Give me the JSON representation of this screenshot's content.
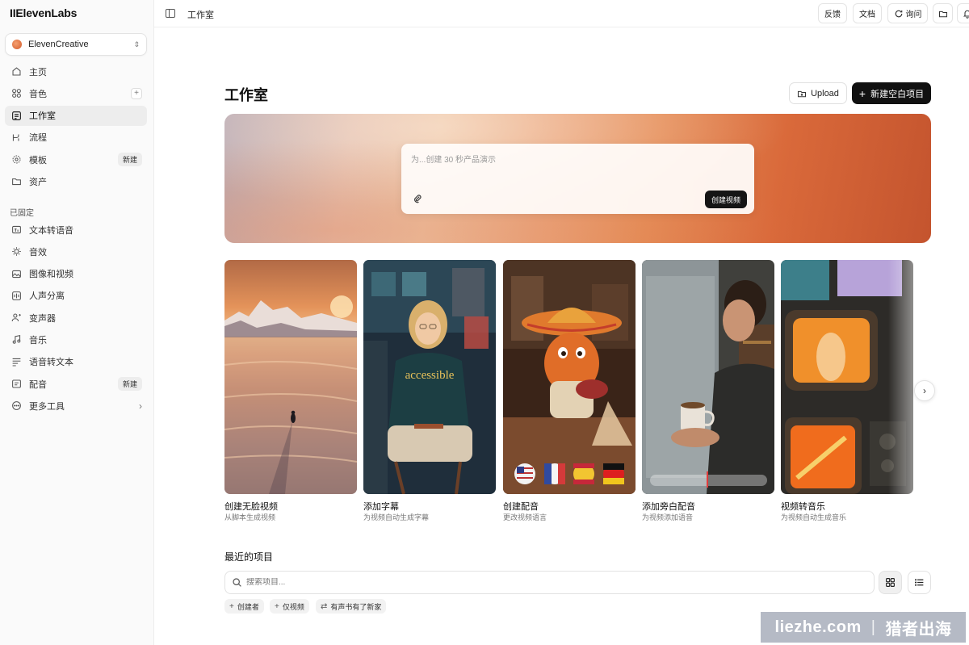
{
  "app": {
    "logo": "IIElevenLabs",
    "workspace": "ElevenCreative"
  },
  "sidebar": {
    "items": [
      {
        "label": "主页",
        "icon": "home-icon"
      },
      {
        "label": "音色",
        "icon": "voices-icon",
        "action": "+"
      },
      {
        "label": "工作室",
        "icon": "studio-icon",
        "active": true
      },
      {
        "label": "流程",
        "icon": "flows-icon"
      },
      {
        "label": "模板",
        "icon": "templates-icon",
        "badge": "新建"
      },
      {
        "label": "资产",
        "icon": "folder-icon"
      }
    ],
    "pinned_label": "已固定",
    "pinned": [
      {
        "label": "文本转语音",
        "icon": "tts-icon"
      },
      {
        "label": "音效",
        "icon": "sound-effects-icon"
      },
      {
        "label": "图像和视频",
        "icon": "image-video-icon"
      },
      {
        "label": "人声分离",
        "icon": "voice-isolator-icon"
      },
      {
        "label": "变声器",
        "icon": "voice-changer-icon"
      },
      {
        "label": "音乐",
        "icon": "music-icon"
      },
      {
        "label": "语音转文本",
        "icon": "stt-icon"
      },
      {
        "label": "配音",
        "icon": "dubbing-icon",
        "badge": "新建"
      },
      {
        "label": "更多工具",
        "icon": "more-icon",
        "chevron": "›"
      }
    ]
  },
  "topbar": {
    "title": "工作室",
    "feedback": "反馈",
    "docs": "文档",
    "ask": "询问"
  },
  "main": {
    "title": "工作室",
    "upload": "Upload",
    "new_project": "新建空白项目",
    "prompt_placeholder": "为...创建 30 秒产品演示",
    "create_video": "创建视频"
  },
  "cards": [
    {
      "title": "创建无脸视频",
      "subtitle": "从脚本生成视频"
    },
    {
      "title": "添加字幕",
      "subtitle": "为视频自动生成字幕",
      "overlay": "accessible"
    },
    {
      "title": "创建配音",
      "subtitle": "更改视频语言"
    },
    {
      "title": "添加旁白配音",
      "subtitle": "为视频添加语音"
    },
    {
      "title": "视频转音乐",
      "subtitle": "为视频自动生成音乐"
    }
  ],
  "recent": {
    "title": "最近的项目",
    "search_placeholder": "搜索项目...",
    "chips": [
      {
        "label": "创建者",
        "icon": "+"
      },
      {
        "label": "仅视频",
        "icon": "+"
      },
      {
        "label": "有声书有了新家",
        "icon": "⇄"
      }
    ]
  },
  "watermark": {
    "left": "liezhe.com",
    "sep": "|",
    "right": "猎者出海"
  },
  "colors": {
    "accent": "#111111",
    "sidebar_bg": "#fafafa",
    "hero_warm": "#d9693a"
  }
}
